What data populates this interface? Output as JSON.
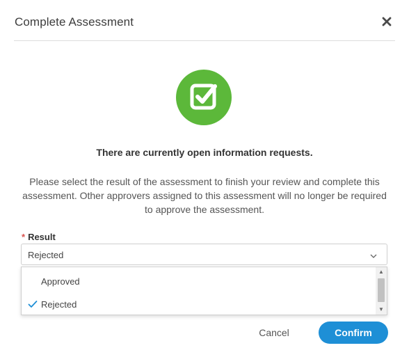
{
  "dialog": {
    "title": "Complete Assessment",
    "close_icon": "close-icon"
  },
  "hero": {
    "icon": "checkbox-check-icon",
    "color": "#5cb83a"
  },
  "message": {
    "heading": "There are currently open information requests.",
    "body": "Please select the result of the assessment to finish your review and complete this assessment. Other approvers assigned to this assessment will no longer be required to approve the assessment."
  },
  "result_field": {
    "required_marker": "*",
    "label": "Result",
    "selected_value": "Rejected",
    "options": [
      {
        "label": "Approved",
        "selected": false
      },
      {
        "label": "Rejected",
        "selected": true
      }
    ]
  },
  "footer": {
    "cancel_label": "Cancel",
    "confirm_label": "Confirm",
    "confirm_color": "#1e8fd6"
  }
}
